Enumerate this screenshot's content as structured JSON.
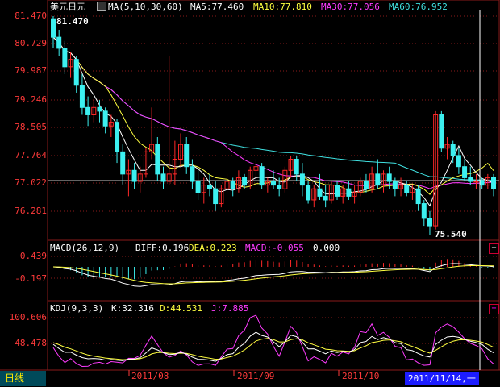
{
  "colors": {
    "up": "#ff2828",
    "down": "#3cf0f0",
    "ma5": "#ffffff",
    "ma10": "#ffff40",
    "ma30": "#ff3cff",
    "ma60": "#40e0e0",
    "axis": "#ff3a3a",
    "grid": "#8a1a1a",
    "bg": "#000000"
  },
  "header": {
    "symbol": "美元日元",
    "ma_label": "MA(5,10,30,60)",
    "ma5_label": "MA5:77.460",
    "ma10_label": "MA10:77.810",
    "ma30_label": "MA30:77.056",
    "ma60_label": "MA60:76.952",
    "toggle_icon": "chart-toggle-icon"
  },
  "price_axis": {
    "labels": [
      "81.470",
      "80.729",
      "79.987",
      "79.246",
      "78.505",
      "77.764",
      "77.022",
      "76.281"
    ],
    "max_marker": "81.470",
    "min_marker": "75.540"
  },
  "macd": {
    "title": "MACD(26,12,9)",
    "diff": "DIFF:0.196",
    "dea": "DEA:0.223",
    "macd": "MACD:-0.055",
    "zero": "0.000",
    "axis_labels": [
      "0.439",
      "-0.197"
    ],
    "expand_btn": "+"
  },
  "kdj": {
    "title": "KDJ(9,3,3)",
    "k": "K:32.316",
    "d": "D:44.531",
    "j": "J:7.885",
    "axis_labels": [
      "100.606",
      "48.478"
    ],
    "expand_btn": "+"
  },
  "footer": {
    "period": "日线",
    "dates": [
      "2011/08",
      "2011/09",
      "2011/10"
    ],
    "cursor_date": "2011/11/14,一"
  },
  "chart_data": {
    "type": "candlestick",
    "price_range": [
      75.54,
      81.47
    ],
    "candles": [
      [
        81.4,
        81.47,
        80.6,
        80.9
      ],
      [
        80.9,
        81.1,
        80.4,
        80.6
      ],
      [
        80.6,
        80.8,
        79.9,
        80.1
      ],
      [
        80.1,
        80.5,
        79.8,
        80.3
      ],
      [
        80.3,
        80.4,
        79.4,
        79.6
      ],
      [
        79.6,
        79.9,
        78.8,
        79.0
      ],
      [
        79.0,
        79.3,
        78.5,
        78.8
      ],
      [
        78.8,
        79.2,
        78.6,
        79.0
      ],
      [
        79.0,
        79.2,
        78.6,
        78.9
      ],
      [
        78.9,
        79.0,
        78.3,
        78.5
      ],
      [
        78.5,
        78.8,
        78.2,
        78.6
      ],
      [
        78.6,
        78.7,
        77.5,
        77.8
      ],
      [
        77.8,
        78.0,
        76.9,
        77.2
      ],
      [
        77.2,
        77.6,
        76.6,
        77.3
      ],
      [
        77.3,
        77.5,
        76.8,
        77.0
      ],
      [
        77.0,
        77.4,
        76.7,
        77.2
      ],
      [
        77.2,
        77.9,
        77.1,
        77.8
      ],
      [
        77.8,
        79.0,
        77.6,
        78.0
      ],
      [
        78.0,
        78.2,
        77.0,
        77.2
      ],
      [
        77.2,
        77.4,
        76.8,
        77.0
      ],
      [
        77.0,
        80.4,
        76.9,
        77.2
      ],
      [
        77.2,
        78.1,
        76.9,
        77.6
      ],
      [
        77.6,
        78.3,
        77.4,
        78.0
      ],
      [
        78.0,
        78.2,
        77.2,
        77.4
      ],
      [
        77.4,
        77.6,
        76.8,
        77.0
      ],
      [
        77.0,
        77.3,
        76.5,
        76.7
      ],
      [
        76.7,
        77.1,
        76.4,
        76.9
      ],
      [
        76.9,
        77.2,
        76.6,
        76.8
      ],
      [
        76.8,
        77.0,
        76.2,
        76.4
      ],
      [
        76.4,
        76.9,
        76.3,
        76.8
      ],
      [
        76.8,
        77.2,
        76.7,
        77.0
      ],
      [
        77.0,
        77.1,
        76.6,
        76.8
      ],
      [
        76.8,
        77.3,
        76.7,
        77.1
      ],
      [
        77.1,
        77.2,
        76.8,
        76.9
      ],
      [
        76.9,
        77.4,
        76.8,
        77.3
      ],
      [
        77.3,
        77.6,
        77.1,
        77.4
      ],
      [
        77.4,
        77.5,
        76.8,
        76.9
      ],
      [
        76.9,
        77.1,
        76.7,
        77.0
      ],
      [
        77.0,
        77.3,
        76.8,
        76.9
      ],
      [
        76.9,
        77.1,
        76.6,
        76.8
      ],
      [
        76.8,
        77.4,
        76.7,
        77.3
      ],
      [
        77.3,
        77.7,
        77.1,
        77.6
      ],
      [
        77.6,
        77.7,
        77.0,
        77.2
      ],
      [
        77.2,
        77.5,
        76.6,
        76.9
      ],
      [
        76.9,
        77.0,
        76.4,
        76.5
      ],
      [
        76.5,
        76.9,
        76.3,
        76.8
      ],
      [
        76.8,
        77.2,
        76.5,
        76.6
      ],
      [
        76.6,
        76.9,
        76.3,
        76.5
      ],
      [
        76.5,
        77.0,
        76.4,
        76.9
      ],
      [
        76.9,
        77.0,
        76.5,
        76.6
      ],
      [
        76.6,
        76.9,
        76.4,
        76.8
      ],
      [
        76.8,
        77.0,
        76.5,
        76.6
      ],
      [
        76.6,
        76.9,
        76.4,
        76.7
      ],
      [
        76.7,
        77.1,
        76.6,
        77.0
      ],
      [
        77.0,
        77.2,
        76.7,
        76.8
      ],
      [
        76.8,
        77.4,
        76.7,
        77.2
      ],
      [
        77.2,
        77.6,
        76.8,
        76.9
      ],
      [
        76.9,
        77.3,
        76.7,
        77.2
      ],
      [
        77.2,
        77.4,
        76.8,
        77.0
      ],
      [
        77.0,
        77.1,
        76.6,
        76.8
      ],
      [
        76.8,
        77.1,
        76.6,
        76.9
      ],
      [
        76.9,
        77.0,
        76.6,
        76.7
      ],
      [
        76.7,
        76.9,
        76.5,
        76.8
      ],
      [
        76.8,
        76.9,
        76.2,
        76.4
      ],
      [
        76.4,
        76.5,
        75.8,
        76.0
      ],
      [
        76.0,
        76.2,
        75.54,
        75.8
      ],
      [
        75.8,
        78.9,
        75.7,
        78.8
      ],
      [
        78.8,
        78.9,
        77.8,
        77.9
      ],
      [
        77.9,
        78.2,
        77.6,
        78.0
      ],
      [
        78.0,
        78.1,
        77.5,
        77.7
      ],
      [
        77.7,
        77.9,
        77.2,
        77.4
      ],
      [
        77.4,
        77.6,
        77.0,
        77.1
      ],
      [
        77.1,
        77.4,
        76.9,
        77.0
      ],
      [
        77.0,
        77.2,
        76.8,
        77.0
      ],
      [
        77.0,
        77.1,
        76.8,
        76.9
      ],
      [
        76.9,
        77.2,
        76.8,
        77.1
      ],
      [
        77.1,
        77.2,
        76.6,
        76.8
      ]
    ]
  }
}
